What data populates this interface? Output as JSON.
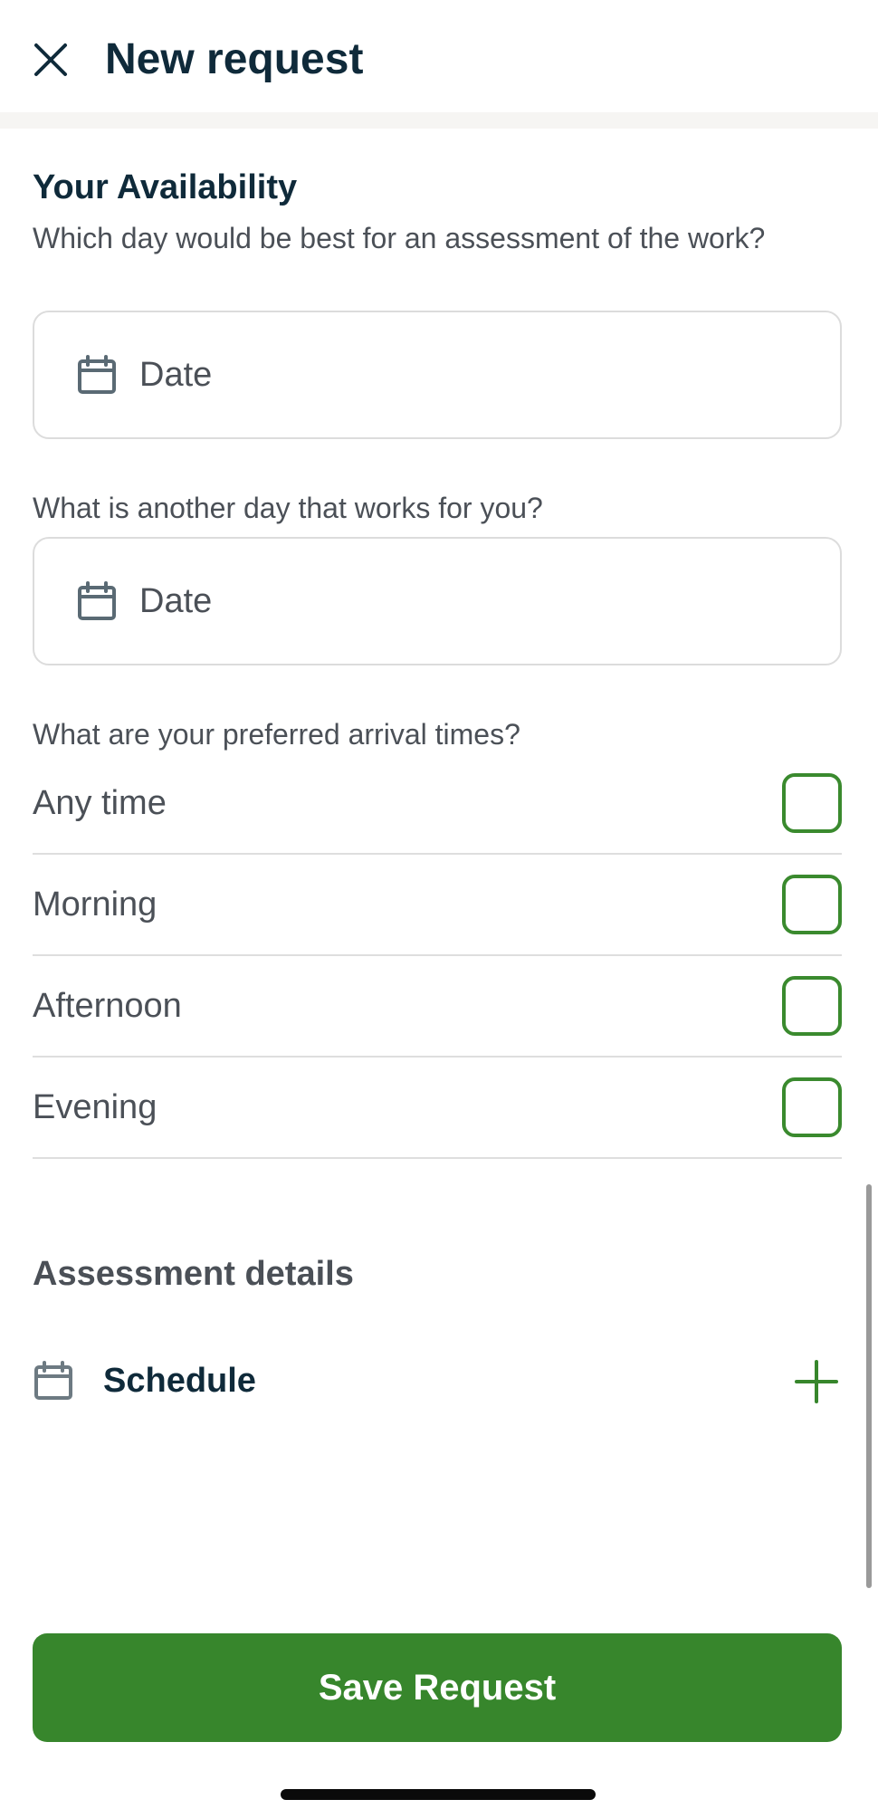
{
  "header": {
    "title": "New request",
    "close_icon": "close-icon"
  },
  "availability": {
    "title": "Your Availability",
    "question_1": "Which day would be best for an assessment of the work?",
    "date_1_placeholder": "Date",
    "question_2": "What is another day that works for you?",
    "date_2_placeholder": "Date",
    "question_3": "What are your preferred arrival times?",
    "options": [
      {
        "label": "Any time",
        "checked": false
      },
      {
        "label": "Morning",
        "checked": false
      },
      {
        "label": "Afternoon",
        "checked": false
      },
      {
        "label": "Evening",
        "checked": false
      }
    ]
  },
  "assessment": {
    "title": "Assessment details",
    "schedule_label": "Schedule",
    "schedule_icon": "calendar-icon",
    "add_icon": "plus-icon"
  },
  "footer": {
    "save_label": "Save Request"
  },
  "colors": {
    "accent": "#37862c",
    "title_text": "#0f2a3a",
    "body_text": "#4b5057"
  }
}
